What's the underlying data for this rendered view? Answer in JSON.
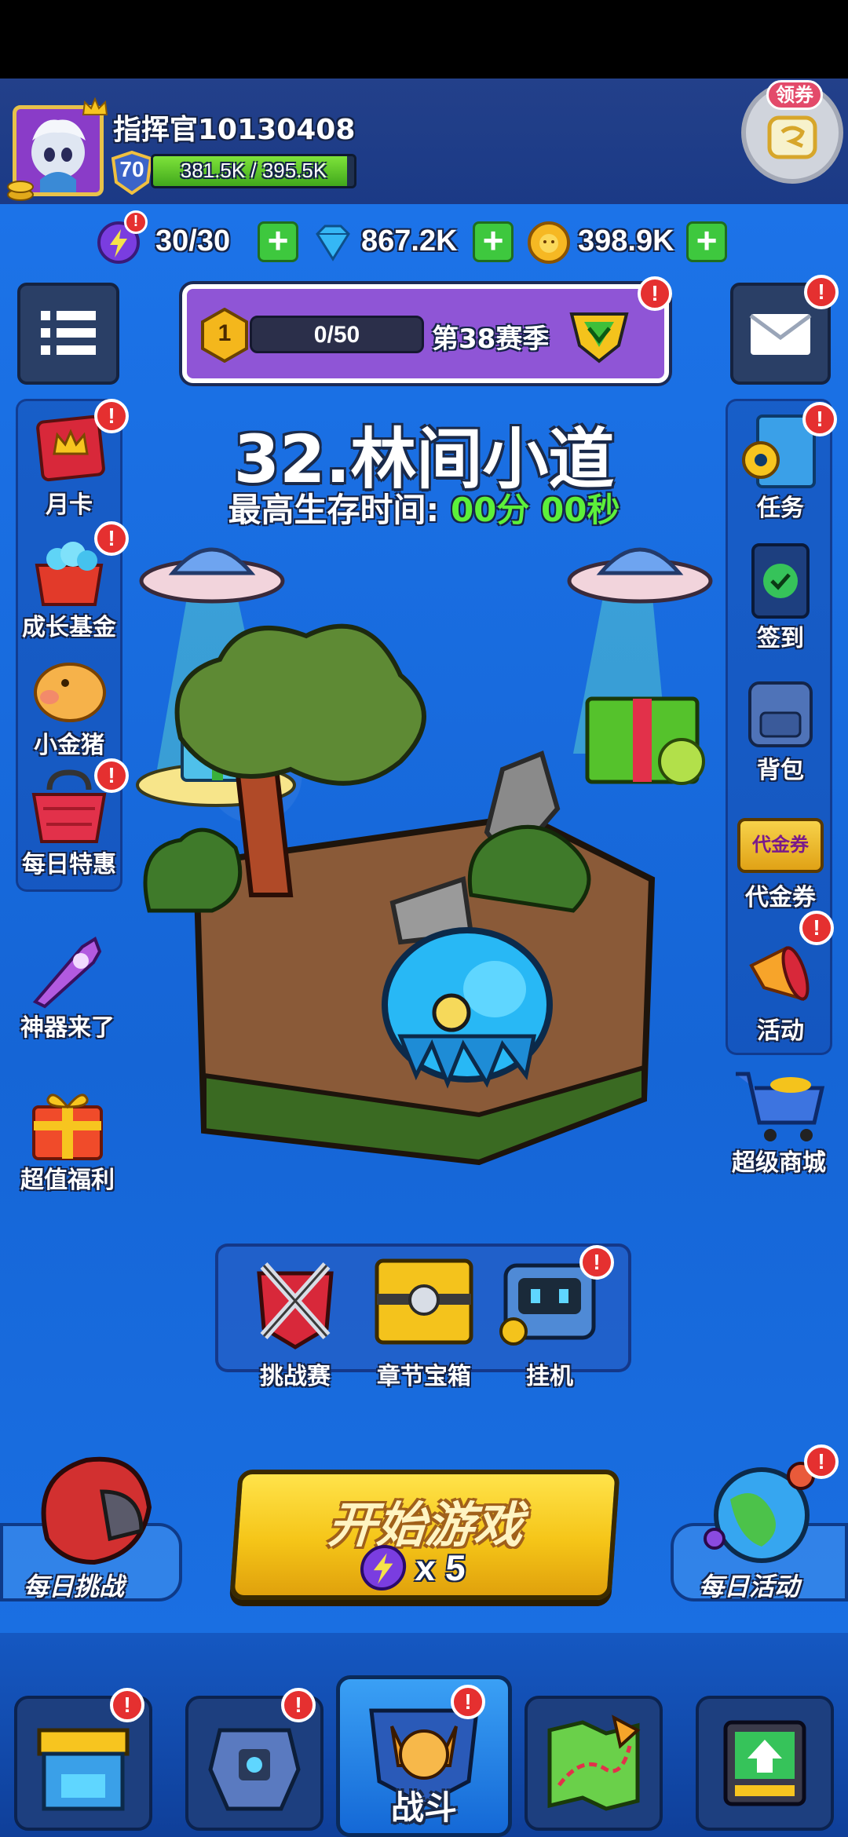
{
  "player": {
    "name": "指挥官10130408",
    "level": "70",
    "exp_text": "381.5K / 395.5K",
    "exp_progress": 0.965
  },
  "coupon_badge": "领券",
  "currencies": {
    "energy": "30/30",
    "diamonds": "867.2K",
    "gold": "398.9K"
  },
  "season": {
    "rank": "1",
    "progress_text": "0/50",
    "progress": 0.0,
    "label": "第38赛季"
  },
  "stage": {
    "title": "32.林间小道",
    "survival_label": "最高生存时间:",
    "survival_value": "00分 00秒"
  },
  "left_menu": [
    {
      "label": "月卡",
      "icon": "month-card-icon",
      "badge": "!"
    },
    {
      "label": "成长基金",
      "icon": "growth-fund-icon",
      "badge": "!"
    },
    {
      "label": "小金猪",
      "icon": "piggy-bank-icon",
      "badge": ""
    },
    {
      "label": "每日特惠",
      "icon": "daily-deal-basket-icon",
      "badge": "!"
    },
    {
      "label": "神器来了",
      "icon": "artifact-weapon-icon",
      "badge": ""
    },
    {
      "label": "超值福利",
      "icon": "gift-box-icon",
      "badge": ""
    }
  ],
  "right_menu": [
    {
      "label": "任务",
      "icon": "quest-book-icon",
      "badge": "!"
    },
    {
      "label": "签到",
      "icon": "check-in-card-icon",
      "badge": ""
    },
    {
      "label": "背包",
      "icon": "backpack-icon",
      "badge": ""
    },
    {
      "label": "代金券",
      "icon": "voucher-icon",
      "badge": "",
      "voucher_text": "代金券"
    },
    {
      "label": "活动",
      "icon": "megaphone-icon",
      "badge": "!"
    },
    {
      "label": "超级商城",
      "icon": "shopping-cart-icon",
      "badge": ""
    }
  ],
  "modes": [
    {
      "label": "挑战赛",
      "icon": "crossed-swords-icon",
      "badge": ""
    },
    {
      "label": "章节宝箱",
      "icon": "chapter-chest-icon",
      "badge": ""
    },
    {
      "label": "挂机",
      "icon": "idle-robot-icon",
      "badge": "!"
    }
  ],
  "daily_challenge": "每日挑战",
  "daily_activity": "每日活动",
  "start_button": {
    "label": "开始游戏",
    "cost": "x 5"
  },
  "bottom_tabs": [
    {
      "name": "shop",
      "icon": "shop-stall-icon",
      "badge": "!",
      "label": ""
    },
    {
      "name": "equipment",
      "icon": "mech-armor-icon",
      "badge": "!",
      "label": ""
    },
    {
      "name": "battle",
      "icon": "battle-cat-icon",
      "badge": "!",
      "label": "战斗"
    },
    {
      "name": "map",
      "icon": "treasure-map-icon",
      "badge": "",
      "label": ""
    },
    {
      "name": "upgrade",
      "icon": "upgrade-chip-icon",
      "badge": "",
      "label": ""
    }
  ],
  "colors": {
    "background": "#1e6fe0",
    "accent_green": "#3ec83e",
    "badge_red": "#e53030",
    "start_yellow": "#f5c518",
    "survival_green": "#5cf03a"
  }
}
